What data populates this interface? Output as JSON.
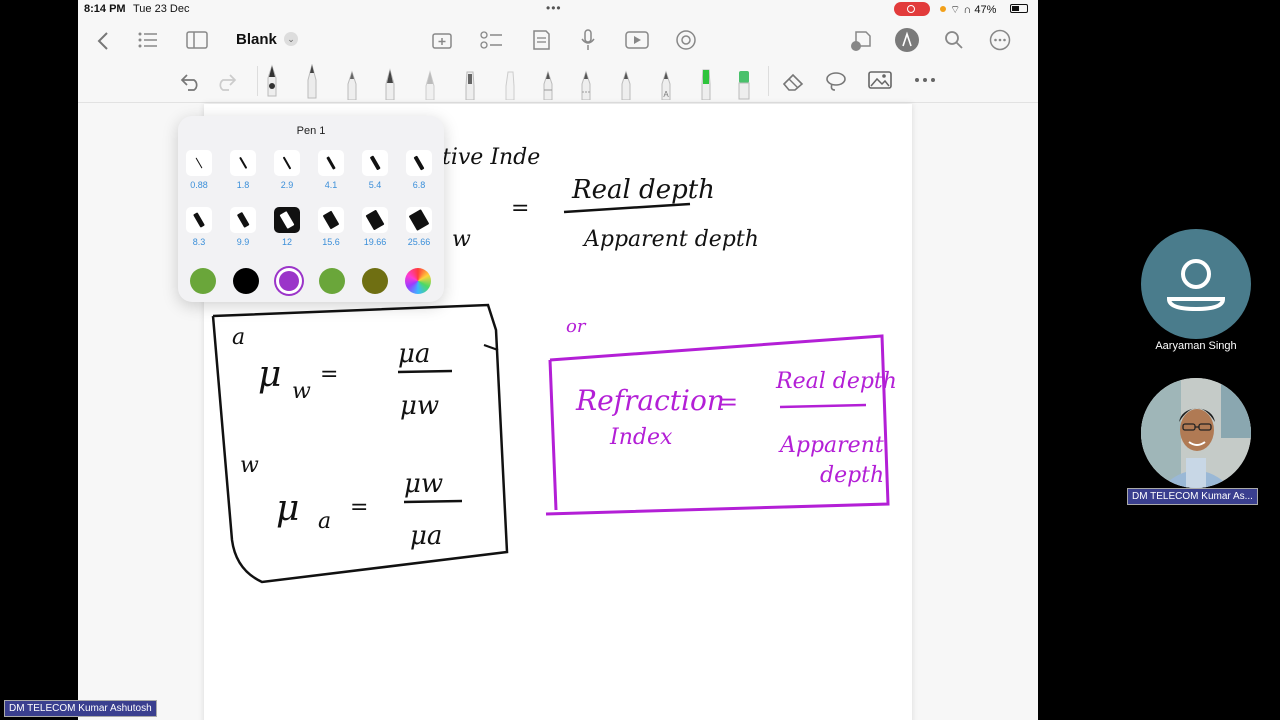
{
  "status_bar": {
    "time": "8:14 PM",
    "date": "Tue 23 Dec",
    "multitask_dots": "•••",
    "battery": "47%"
  },
  "toolbar": {
    "title": "Blank"
  },
  "pen_popover": {
    "title": "Pen 1",
    "widths": [
      "0.88",
      "1.8",
      "2.9",
      "4.1",
      "5.4",
      "6.8",
      "8.3",
      "9.9",
      "12",
      "15.6",
      "19.66",
      "25.66"
    ],
    "selected_width": "12",
    "colors": [
      "#6aa63a",
      "#000000",
      "#9b35c9",
      "#6aa63a",
      "#6f6f12",
      "spectrum"
    ],
    "selected_color": "#9b35c9"
  },
  "participants": [
    {
      "name": "Aaryaman Singh",
      "video": false
    },
    {
      "name": "DM TELECOM Kumar As...",
      "video": true
    }
  ],
  "presenter_tag": "DM TELECOM Kumar Ashutosh",
  "note_text": {
    "partial_top_a": "tive Inde",
    "real_depth": "Real depth",
    "apparent_depth": "Apparent depth",
    "eq": "=",
    "w_frag": "w",
    "box_a_super": "a",
    "mu": "μ",
    "w_sub": "w",
    "mu_a": "μa",
    "mu_w": "μw",
    "box_w_super": "w",
    "a_sub": "a",
    "or": "or",
    "refraction": "Refraction",
    "index": "Index",
    "real_depth2": "Real depth",
    "apparent2": "Apparent",
    "depth2": "depth"
  },
  "colors": {
    "ink_black": "#111111",
    "ink_purple": "#b31fd6",
    "avatar_bg": "#4a7c8c",
    "tag_bg": "#3a3f8f",
    "width_label": "#3b8fd9"
  }
}
